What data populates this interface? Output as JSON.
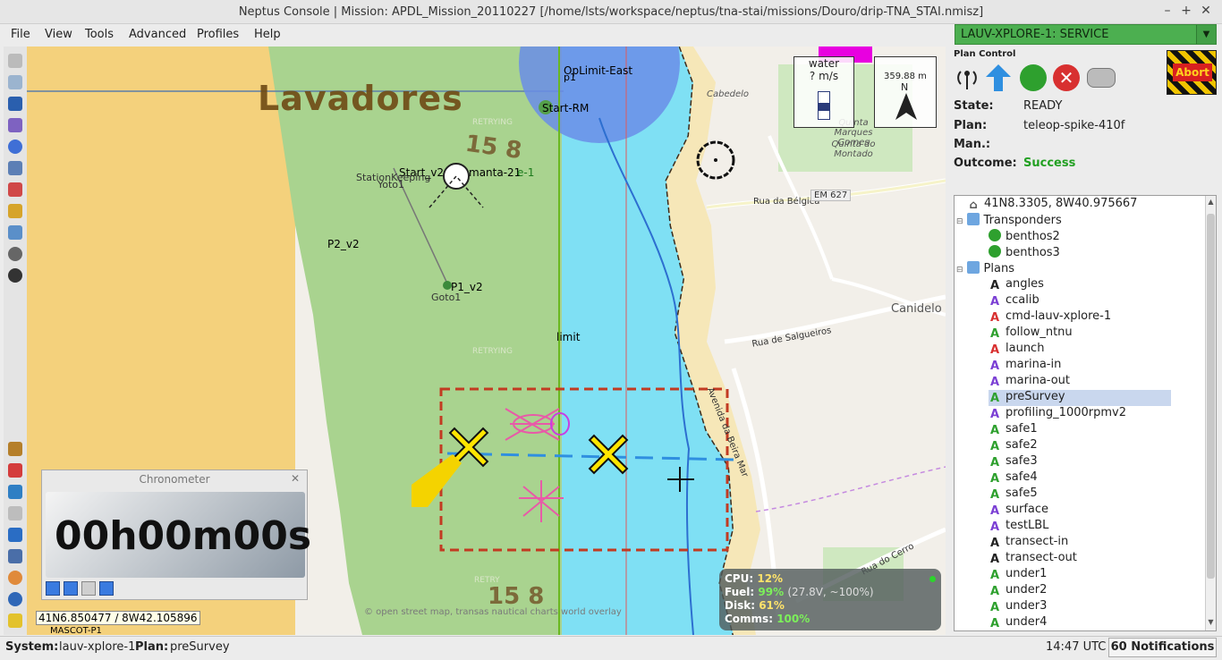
{
  "window": {
    "title": "Neptus Console | Mission: APDL_Mission_20110227 [/home/lsts/workspace/neptus/tna-stai/missions/Douro/drip-TNA_STAI.nmisz]",
    "minimize": "–",
    "maximize": "+",
    "close": "✕"
  },
  "menu": [
    "File",
    "View",
    "Tools",
    "Advanced",
    "Profiles",
    "Help"
  ],
  "vehicle_selector": {
    "value": "LAUV-XPLORE-1: SERVICE",
    "arrow": "▼"
  },
  "map": {
    "place_label": "Lavadores",
    "depth_label_1": "15 8",
    "depth_label_2": "15 8",
    "markers": [
      "OpLimit-East",
      "p1",
      "Start-RM",
      "Start_v2",
      "StationKeeping",
      "Yoto1",
      "manta-21",
      "e-1",
      "P2_v2",
      "P1_v2",
      "Goto1",
      "limit",
      "MASCOT-P1"
    ],
    "retrying": [
      "RETRYING",
      "RETRYING",
      "RETRY"
    ],
    "streets": [
      "Cabedelo",
      "Quinta Marques Gomes",
      "Quinta do Montado",
      "Rua da Bélgica",
      "EM 627",
      "Canidelo",
      "Rua de Salgueiros",
      "Avenida da Beira Mar",
      "Rua do Cerro"
    ],
    "attribution": "© open street map, transas nautical charts world overlay",
    "coords": "41N6.850477 / 8W42.105896",
    "water_widget": {
      "title": "water",
      "value": "? m/s"
    },
    "compass": {
      "heading": "359.88 m",
      "north": "N"
    }
  },
  "chronometer": {
    "title": "Chronometer",
    "close": "✕",
    "time": "00h00m00s"
  },
  "sysinfo": {
    "cpu_label": "CPU:",
    "cpu": "12%",
    "fuel_label": "Fuel:",
    "fuel": "99%",
    "fuel_extra": "(27.8V, ~100%)",
    "disk_label": "Disk:",
    "disk": "61%",
    "comms_label": "Comms:",
    "comms": "100%"
  },
  "plan_control": {
    "title": "Plan Control",
    "abort": "Abort",
    "state_label": "State:",
    "state": "READY",
    "plan_label": "Plan:",
    "plan": "teleop-spike-410f",
    "man_label": "Man.:",
    "man": "",
    "outcome_label": "Outcome:",
    "outcome": "Success"
  },
  "tree": {
    "home": "41N8.3305, 8W40.975667",
    "transponders_label": "Transponders",
    "transponders": [
      "benthos2",
      "benthos3"
    ],
    "plans_label": "Plans",
    "plans": [
      {
        "name": "angles",
        "color": "#222222"
      },
      {
        "name": "ccalib",
        "color": "#7b3fd4"
      },
      {
        "name": "cmd-lauv-xplore-1",
        "color": "#d83030"
      },
      {
        "name": "follow_ntnu",
        "color": "#2ea02e"
      },
      {
        "name": "launch",
        "color": "#d83030"
      },
      {
        "name": "marina-in",
        "color": "#7b3fd4"
      },
      {
        "name": "marina-out",
        "color": "#7b3fd4"
      },
      {
        "name": "preSurvey",
        "color": "#2ea02e"
      },
      {
        "name": "profiling_1000rpmv2",
        "color": "#7b3fd4"
      },
      {
        "name": "safe1",
        "color": "#2ea02e"
      },
      {
        "name": "safe2",
        "color": "#2ea02e"
      },
      {
        "name": "safe3",
        "color": "#2ea02e"
      },
      {
        "name": "safe4",
        "color": "#2ea02e"
      },
      {
        "name": "safe5",
        "color": "#2ea02e"
      },
      {
        "name": "surface",
        "color": "#7b3fd4"
      },
      {
        "name": "testLBL",
        "color": "#7b3fd4"
      },
      {
        "name": "transect-in",
        "color": "#222222"
      },
      {
        "name": "transect-out",
        "color": "#222222"
      },
      {
        "name": "under1",
        "color": "#2ea02e"
      },
      {
        "name": "under2",
        "color": "#2ea02e"
      },
      {
        "name": "under3",
        "color": "#2ea02e"
      },
      {
        "name": "under4",
        "color": "#2ea02e"
      }
    ],
    "selected": "preSurvey"
  },
  "status": {
    "system_label": "System:",
    "system": "lauv-xplore-1",
    "plan_label": "Plan:",
    "plan": "preSurvey",
    "time": "14:47 UTC",
    "notifications": "60 Notifications"
  }
}
